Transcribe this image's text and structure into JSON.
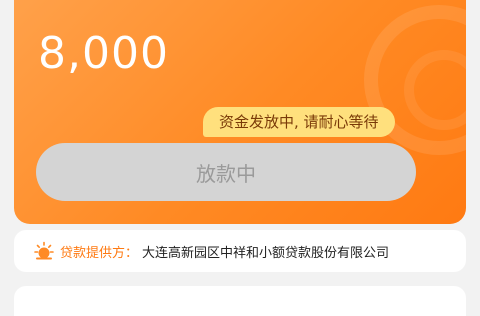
{
  "loan": {
    "amount": "8,000",
    "status_label": "放款中",
    "tooltip": "资金发放中, 请耐心等待"
  },
  "provider": {
    "label": "贷款提供方：",
    "company": "大连高新园区中祥和小额贷款股份有限公司",
    "icon": "sun-icon"
  },
  "colors": {
    "accent": "#ff8a24",
    "tooltip_bg": "#ffe07d",
    "disabled_button": "#d4d4d4"
  }
}
